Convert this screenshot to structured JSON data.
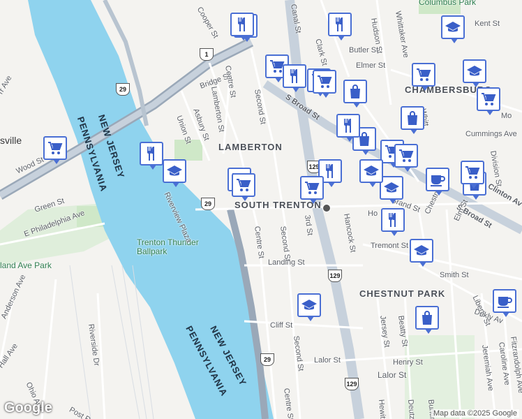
{
  "neighborhoods": [
    {
      "id": "lamberton",
      "text": "LAMBERTON"
    },
    {
      "id": "south-trenton",
      "text": "SOUTH TRENTON"
    },
    {
      "id": "chestnut-park",
      "text": "CHESTNUT PARK"
    },
    {
      "id": "chambersburg",
      "text": "CHAMBERSBURG"
    }
  ],
  "states": [
    "NEW JERSEY",
    "PENNSYLVANIA",
    "PENNSYLVANIA",
    "NEW JERSEY"
  ],
  "parks": {
    "columbus": "Columbus Park",
    "ballpark": "Trenton Thunder Ballpark",
    "island": "land Ave Park"
  },
  "town": "sville",
  "streets": [
    "Cooper St",
    "Canal St",
    "Clark St",
    "Hudson St",
    "Whittaker Ave",
    "Kent St",
    "Butler St",
    "Elmer St",
    "Bridge St",
    "Centre St",
    "Lamberton St",
    "Second St",
    "S Broad St",
    "Asbury St",
    "Union St",
    "Cummings Ave",
    "Division St",
    "Clinton Av",
    "S Broad St",
    "Grand St",
    "Hancock St",
    "Chestnut Ave",
    "Elm St",
    "Tremont St",
    "Smith St",
    "Landing St",
    "Centre St",
    "Second St",
    "3rd St",
    "Liberty St",
    "Dekly Av",
    "Cliff St",
    "Second St",
    "Jersey St",
    "Beatty St",
    "Lalor St",
    "Henry St",
    "Lalor St",
    "Jeremiah Ave",
    "Caroline Ave",
    "Fitzrandolph Ave",
    "Riverside Dr",
    "Anderson Ave",
    "Hall Ave",
    "Ohio Ave",
    "Post Rd",
    "Green St",
    "E Philadelphia Ave",
    "Wood St",
    "Riverview Plaza",
    "Centre St",
    "Hewitt",
    "Deutz",
    "Bunting",
    "Mo",
    "Ho",
    "Fr",
    "Whitt",
    "rr Ave"
  ],
  "shields": [
    "29",
    "1",
    "29",
    "129",
    "129",
    "29",
    "129"
  ],
  "pois": [
    "restaurant",
    "restaurant",
    "shopping-cart",
    "shopping-cart",
    "restaurant",
    "shopping-cart",
    "shopping-cart",
    "school",
    "shopping-bag",
    "school",
    "shopping-cart",
    "restaurant",
    "shopping-bag",
    "shopping-bag",
    "shopping-cart",
    "shopping-cart",
    "restaurant",
    "school",
    "shopping-cart",
    "restaurant",
    "shopping-cart",
    "school",
    "cafe",
    "shopping-cart",
    "shopping-bag",
    "school",
    "restaurant",
    "school",
    "school",
    "shopping-bag",
    "cafe",
    "shopping-cart",
    "restaurant",
    "shopping-cart"
  ],
  "attribution": "Map data ©2025 Google",
  "google_logo": "Google",
  "colors": {
    "water": "#8fd3ee",
    "poi_border": "#4a6fd4",
    "highway": "#9aa8b8",
    "park": "#cfe8c8"
  }
}
